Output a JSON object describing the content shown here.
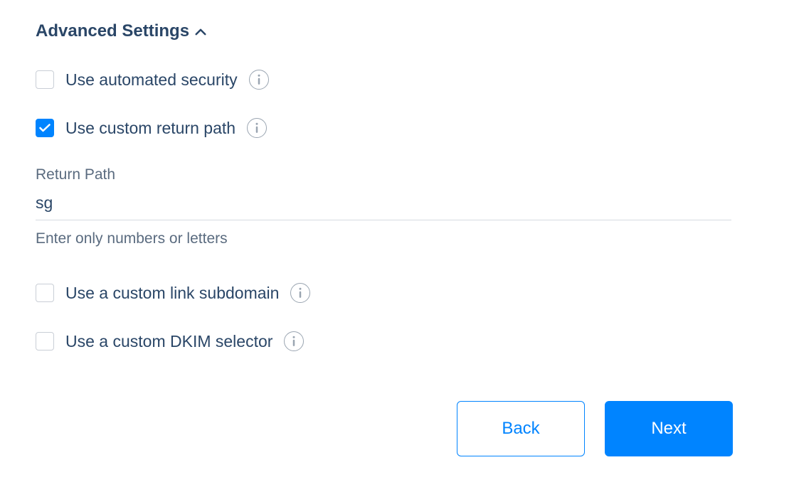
{
  "section": {
    "title": "Advanced Settings"
  },
  "options": {
    "automated_security": {
      "label": "Use automated security",
      "checked": false
    },
    "custom_return_path": {
      "label": "Use custom return path",
      "checked": true
    },
    "custom_link_subdomain": {
      "label": "Use a custom link subdomain",
      "checked": false
    },
    "custom_dkim_selector": {
      "label": "Use a custom DKIM selector",
      "checked": false
    }
  },
  "return_path": {
    "label": "Return Path",
    "value": "sg",
    "hint": "Enter only numbers or letters"
  },
  "buttons": {
    "back": "Back",
    "next": "Next"
  }
}
